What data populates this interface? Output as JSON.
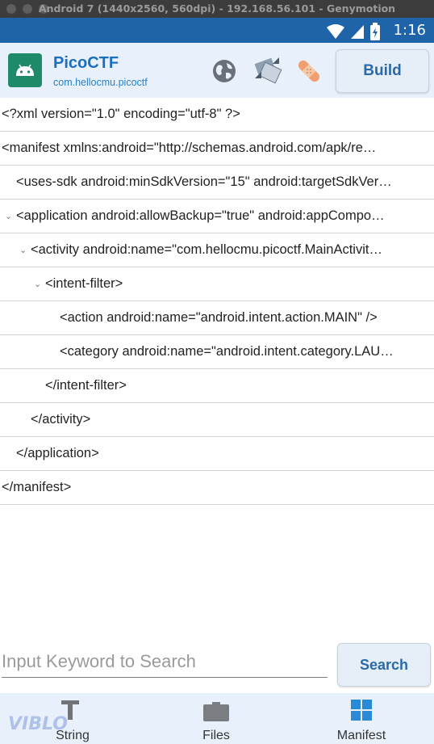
{
  "window": {
    "title": "Android 7 (1440x2560, 560dpi) - 192.168.56.101 - Genymotion"
  },
  "statusbar": {
    "time": "1:16"
  },
  "appbar": {
    "app_name": "PicoCTF",
    "package": "com.hellocmu.picoctf",
    "build_label": "Build",
    "icons": [
      "globe-icon",
      "resize-icon",
      "bandage-icon"
    ]
  },
  "tree": {
    "rows": [
      {
        "text": "<?xml version=\"1.0\" encoding=\"utf-8\" ?>",
        "expanded": null
      },
      {
        "text": "<manifest xmlns:android=\"http://schemas.android.com/apk/re…",
        "expanded": null
      },
      {
        "text": "<uses-sdk android:minSdkVersion=\"15\" android:targetSdkVer…",
        "expanded": null
      },
      {
        "text": "<application android:allowBackup=\"true\" android:appCompo…",
        "expanded": true
      },
      {
        "text": "<activity android:name=\"com.hellocmu.picoctf.MainActivit…",
        "expanded": true
      },
      {
        "text": "<intent-filter>",
        "expanded": true
      },
      {
        "text": "<action android:name=\"android.intent.action.MAIN\" />",
        "expanded": null
      },
      {
        "text": "<category android:name=\"android.intent.category.LAU…",
        "expanded": null
      },
      {
        "text": "</intent-filter>",
        "expanded": null
      },
      {
        "text": "</activity>",
        "expanded": null
      },
      {
        "text": "</application>",
        "expanded": null
      },
      {
        "text": "</manifest>",
        "expanded": null
      }
    ]
  },
  "search": {
    "placeholder": "Input Keyword to Search",
    "value": "",
    "button_label": "Search"
  },
  "bottomnav": {
    "items": [
      {
        "label": "String",
        "icon": "text-icon"
      },
      {
        "label": "Files",
        "icon": "folder-icon"
      },
      {
        "label": "Manifest",
        "icon": "grid-icon",
        "active": true
      }
    ]
  },
  "watermark": "VIBLO",
  "colors": {
    "status_bar": "#1f64a8",
    "appbar_bg": "#e8f1fb",
    "accent": "#1a6fbf",
    "logo_bg": "#1e8a6a",
    "manifest_icon": "#2a8ad8"
  }
}
